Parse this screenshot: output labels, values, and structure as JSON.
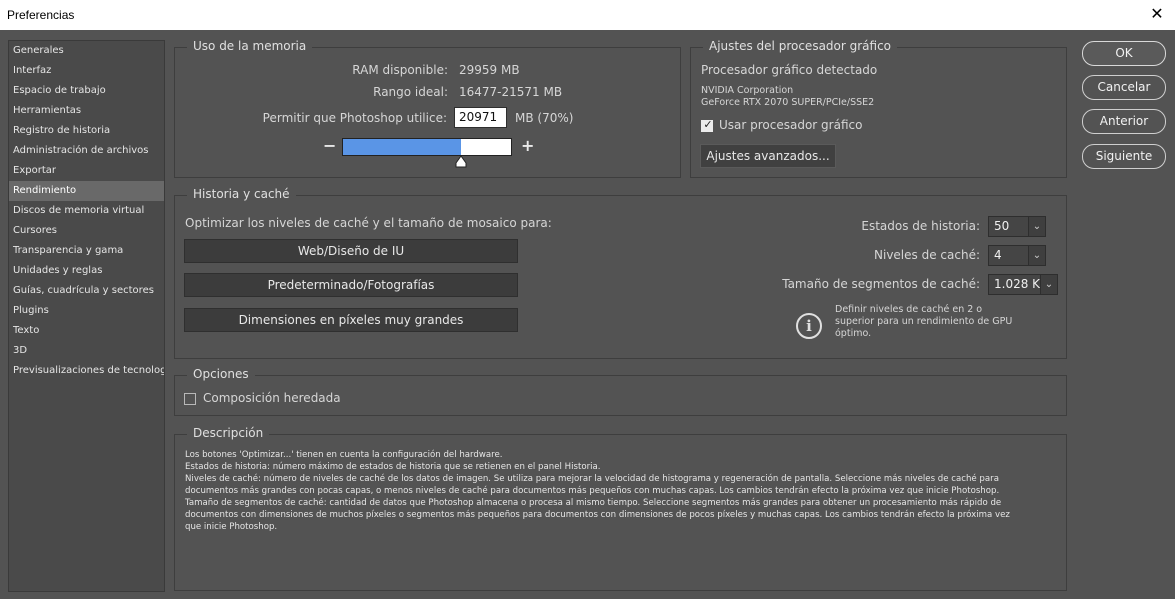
{
  "window": {
    "title": "Preferencias",
    "close_glyph": "✕"
  },
  "sidebar": {
    "items": [
      {
        "label": "Generales",
        "active": false
      },
      {
        "label": "Interfaz",
        "active": false
      },
      {
        "label": "Espacio de trabajo",
        "active": false
      },
      {
        "label": "Herramientas",
        "active": false
      },
      {
        "label": "Registro de historia",
        "active": false
      },
      {
        "label": "Administración de archivos",
        "active": false
      },
      {
        "label": "Exportar",
        "active": false
      },
      {
        "label": "Rendimiento",
        "active": true
      },
      {
        "label": "Discos de memoria virtual",
        "active": false
      },
      {
        "label": "Cursores",
        "active": false
      },
      {
        "label": "Transparencia y gama",
        "active": false
      },
      {
        "label": "Unidades y reglas",
        "active": false
      },
      {
        "label": "Guías, cuadrícula y sectores",
        "active": false
      },
      {
        "label": "Plugins",
        "active": false
      },
      {
        "label": "Texto",
        "active": false
      },
      {
        "label": "3D",
        "active": false
      },
      {
        "label": "Previsualizaciones de tecnología",
        "active": false
      }
    ]
  },
  "memory": {
    "title": "Uso de la memoria",
    "ram_label": "RAM disponible:",
    "ram_value": "29959 MB",
    "range_label": "Rango ideal:",
    "range_value": "16477-21571 MB",
    "allow_label": "Permitir que Photoshop utilice:",
    "allow_value": "20971",
    "allow_unit": "MB (70%)",
    "slider_fraction": 0.7,
    "minus": "−",
    "plus": "+"
  },
  "gpu": {
    "title": "Ajustes del procesador gráfico",
    "detected_label": "Procesador gráfico detectado",
    "vendor": "NVIDIA Corporation",
    "model": "GeForce RTX 2070 SUPER/PCIe/SSE2",
    "use_gpu_label": "Usar procesador gráfico",
    "use_gpu_checked": true,
    "advanced_button": "Ajustes avanzados..."
  },
  "history_cache": {
    "title": "Historia y caché",
    "optimize_label": "Optimizar los niveles de caché y el tamaño de mosaico para:",
    "btn_web": "Web/Diseño de IU",
    "btn_default": "Predeterminado/Fotografías",
    "btn_large": "Dimensiones en píxeles muy grandes",
    "history_states_label": "Estados de historia:",
    "history_states_value": "50",
    "cache_levels_label": "Niveles de caché:",
    "cache_levels_value": "4",
    "tile_size_label": "Tamaño de segmentos de caché:",
    "tile_size_value": "1.028 K",
    "info_line1": "Definir niveles de caché en 2 o",
    "info_line2": "superior para un rendimiento de GPU",
    "info_line3": "óptimo."
  },
  "options": {
    "title": "Opciones",
    "legacy_label": "Composición heredada",
    "legacy_checked": false
  },
  "description": {
    "title": "Descripción",
    "lines": [
      "Los botones 'Optimizar...' tienen en cuenta la configuración del hardware.",
      "Estados de historia: número máximo de estados de historia que se retienen en el panel Historia.",
      "Niveles de caché: número de niveles de caché de los datos de imagen. Se utiliza para mejorar la velocidad de histograma y regeneración de pantalla. Seleccione más niveles de caché para",
      "documentos más grandes con pocas capas, o menos niveles de caché para documentos más pequeños con muchas capas. Los cambios tendrán efecto la próxima vez que inicie Photoshop.",
      "Tamaño de segmentos de caché: cantidad de datos que Photoshop almacena o procesa al mismo tiempo. Seleccione segmentos más grandes para obtener un procesamiento más rápido de",
      "documentos con dimensiones de muchos píxeles o segmentos más pequeños para documentos con dimensiones de pocos píxeles y muchas capas. Los cambios tendrán efecto la próxima vez",
      "que inicie Photoshop."
    ]
  },
  "buttons": {
    "ok": "OK",
    "cancel": "Cancelar",
    "previous": "Anterior",
    "next": "Siguiente"
  }
}
